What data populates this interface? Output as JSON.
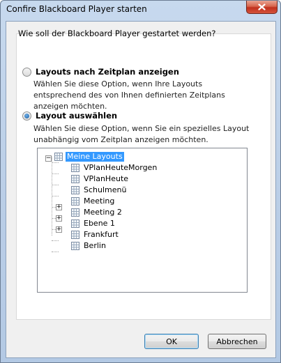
{
  "window": {
    "title": "Confire Blackboard Player starten"
  },
  "dialog": {
    "question": "Wie soll der Blackboard Player gestartet werden?",
    "options": [
      {
        "label": "Layouts nach Zeitplan anzeigen",
        "description": "Wählen Sie diese Option, wenn Ihre Layouts entsprechend des von Ihnen definierten Zeitplans anzeigen möchten.",
        "checked": false
      },
      {
        "label": "Layout auswählen",
        "description": "Wählen Sie diese Option, wenn Sie ein spezielles Layout unabhängig vom Zeitplan anzeigen möchten.",
        "checked": true
      }
    ],
    "tree": {
      "root": {
        "label": "Meine Layouts",
        "expanded": true,
        "selected": true
      },
      "items": [
        {
          "label": "VPlanHeuteMorgen",
          "expandable": false
        },
        {
          "label": "VPlanHeute",
          "expandable": false
        },
        {
          "label": "Schulmenü",
          "expandable": false
        },
        {
          "label": "Meeting",
          "expandable": false
        },
        {
          "label": "Meeting 2",
          "expandable": true
        },
        {
          "label": "Ebene 1",
          "expandable": true
        },
        {
          "label": "Frankfurt",
          "expandable": true
        },
        {
          "label": "Berlin",
          "expandable": false
        }
      ]
    }
  },
  "buttons": {
    "ok": "OK",
    "cancel": "Abbrechen"
  },
  "colors": {
    "selection": "#3399ff",
    "titlebar": "#c7d9ee",
    "close": "#c0301d"
  }
}
